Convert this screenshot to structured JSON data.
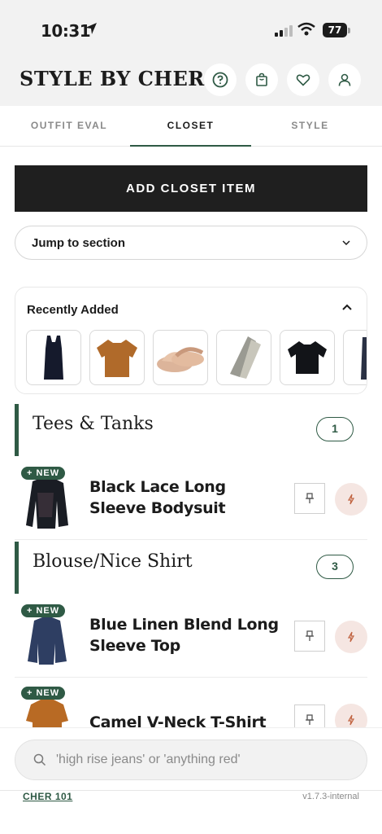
{
  "status_bar": {
    "time": "10:31",
    "battery": "77"
  },
  "header": {
    "brand": "STYLE BY CHER"
  },
  "tabs": [
    {
      "label": "OUTFIT EVAL",
      "active": false
    },
    {
      "label": "CLOSET",
      "active": true
    },
    {
      "label": "STYLE",
      "active": false
    }
  ],
  "add_button": {
    "label": "ADD CLOSET ITEM"
  },
  "jump": {
    "label": "Jump to section"
  },
  "recent": {
    "title": "Recently Added"
  },
  "categories": [
    {
      "title": "Tees & Tanks",
      "count": "1"
    },
    {
      "title": "Blouse/Nice Shirt",
      "count": "3"
    }
  ],
  "items": [
    {
      "badge": "+ NEW",
      "name": "Black Lace Long Sleeve Bodysuit"
    },
    {
      "badge": "+ NEW",
      "name": "Blue Linen Blend Long Sleeve Top"
    },
    {
      "badge": "+ NEW",
      "name": "Camel V-Neck T-Shirt"
    }
  ],
  "search": {
    "placeholder": "'high rise jeans' or 'anything red'"
  },
  "footer": {
    "link": "CHER 101",
    "version": "v1.7.3-internal"
  },
  "colors": {
    "accent": "#2f5a45",
    "dark": "#1f1f1f",
    "flash_bg": "#f5e6e2"
  }
}
